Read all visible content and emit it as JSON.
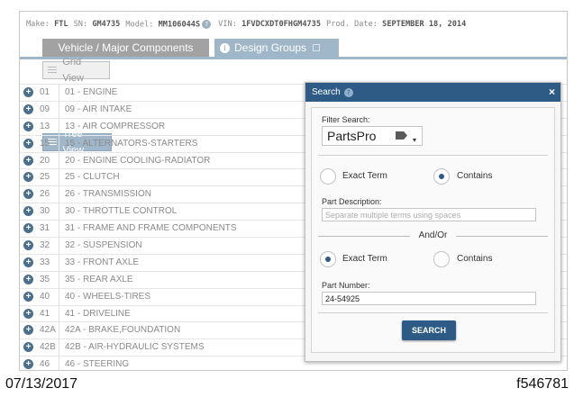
{
  "info": {
    "make_label": "Make:",
    "make": "FTL",
    "sn_label": "SN:",
    "sn": "GM4735",
    "model_label": "Model:",
    "model": "MM106044S",
    "vin_label": "VIN:",
    "vin": "1FVDCXDT0FHGM4735",
    "prod_label": "Prod. Date:",
    "prod": "SEPTEMBER 18, 2014"
  },
  "tabs": [
    {
      "label": "Vehicle / Major Components"
    },
    {
      "label": "Design Groups"
    }
  ],
  "views": [
    {
      "label": "Tree View",
      "active": true
    },
    {
      "label": "Grid View",
      "active": false
    }
  ],
  "tree": [
    {
      "code": "01",
      "desc": "01 - ENGINE"
    },
    {
      "code": "09",
      "desc": "09 - AIR INTAKE"
    },
    {
      "code": "13",
      "desc": "13 - AIR COMPRESSOR"
    },
    {
      "code": "15",
      "desc": "15 - ALTERNATORS-STARTERS"
    },
    {
      "code": "20",
      "desc": "20 - ENGINE COOLING-RADIATOR"
    },
    {
      "code": "25",
      "desc": "25 - CLUTCH"
    },
    {
      "code": "26",
      "desc": "26 - TRANSMISSION"
    },
    {
      "code": "30",
      "desc": "30 - THROTTLE CONTROL"
    },
    {
      "code": "31",
      "desc": "31 - FRAME AND FRAME COMPONENTS"
    },
    {
      "code": "32",
      "desc": "32 - SUSPENSION"
    },
    {
      "code": "33",
      "desc": "33 - FRONT AXLE"
    },
    {
      "code": "35",
      "desc": "35 - REAR AXLE"
    },
    {
      "code": "40",
      "desc": "40 - WHEELS-TIRES"
    },
    {
      "code": "41",
      "desc": "41 - DRIVELINE"
    },
    {
      "code": "42A",
      "desc": "42A - BRAKE,FOUNDATION"
    },
    {
      "code": "42B",
      "desc": "42B - AIR-HYDRAULIC SYSTEMS"
    },
    {
      "code": "46",
      "desc": "46 - STEERING"
    }
  ],
  "dialog": {
    "title": "Search",
    "close_glyph": "×",
    "filter_label": "Filter Search:",
    "filter_value": "PartsPro",
    "desc_radio": [
      {
        "label": "Exact Term",
        "checked": false
      },
      {
        "label": "Contains",
        "checked": true
      }
    ],
    "part_desc_label": "Part Description:",
    "part_desc_value": "",
    "part_desc_placeholder": "Separate multiple terms using spaces",
    "andor": "And/Or",
    "num_radio": [
      {
        "label": "Exact Term",
        "checked": true
      },
      {
        "label": "Contains",
        "checked": false
      }
    ],
    "part_num_label": "Part Number:",
    "part_num_value": "24-54925",
    "search_label": "SEARCH"
  },
  "footer": {
    "date": "07/13/2017",
    "figure_id": "f546781"
  },
  "colors": {
    "header_blue": "#2e5b86",
    "tab_blue": "#9fb7c9",
    "tab_gray": "#a2a2a2"
  }
}
